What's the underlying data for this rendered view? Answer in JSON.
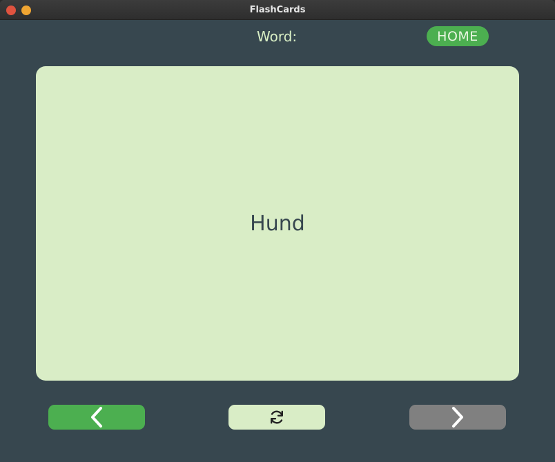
{
  "window": {
    "title": "FlashCards"
  },
  "header": {
    "word_label": "Word:",
    "home_label": "HOME"
  },
  "card": {
    "word": "Hund"
  },
  "controls": {
    "prev_icon": "chevron-left-icon",
    "flip_icon": "refresh-icon",
    "next_icon": "chevron-right-icon"
  },
  "colors": {
    "background": "#37474f",
    "accent_green": "#4caf50",
    "card_bg": "#d9edc6",
    "disabled_gray": "#808080",
    "text_light": "#d9efc5"
  }
}
